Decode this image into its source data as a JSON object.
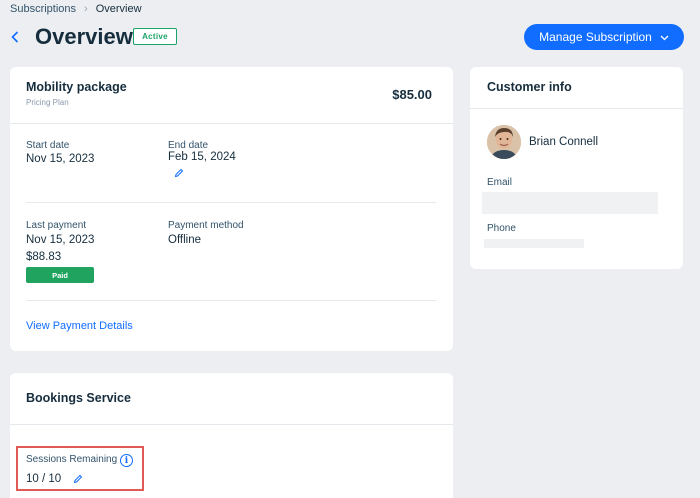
{
  "breadcrumb": {
    "items": [
      "Subscriptions",
      "Overview"
    ]
  },
  "header": {
    "title": "Overview",
    "status_badge": "Active",
    "manage_button": "Manage Subscription"
  },
  "plan_card": {
    "name": "Mobility package",
    "type": "Pricing Plan",
    "price": "$85.00",
    "start_date_label": "Start date",
    "start_date": "Nov 15, 2023",
    "end_date_label": "End date",
    "end_date": "Feb 15, 2024",
    "last_payment_label": "Last payment",
    "last_payment_date": "Nov 15, 2023",
    "last_payment_amount": "$88.83",
    "paid_badge": "Paid",
    "payment_method_label": "Payment method",
    "payment_method": "Offline",
    "view_details_link": "View Payment Details"
  },
  "customer_card": {
    "title": "Customer info",
    "name": "Brian Connell",
    "email_label": "Email",
    "phone_label": "Phone"
  },
  "bookings_card": {
    "title": "Bookings Service",
    "sessions_label": "Sessions Remaining",
    "sessions_value": "10 / 10"
  },
  "colors": {
    "accent": "#116dff",
    "active": "#1aa36a",
    "paid": "#20a35f",
    "highlight": "#e25a54"
  },
  "icons": [
    "chevron-left-icon",
    "chevron-right-icon",
    "chevron-down-icon",
    "pencil-icon",
    "info-icon"
  ]
}
